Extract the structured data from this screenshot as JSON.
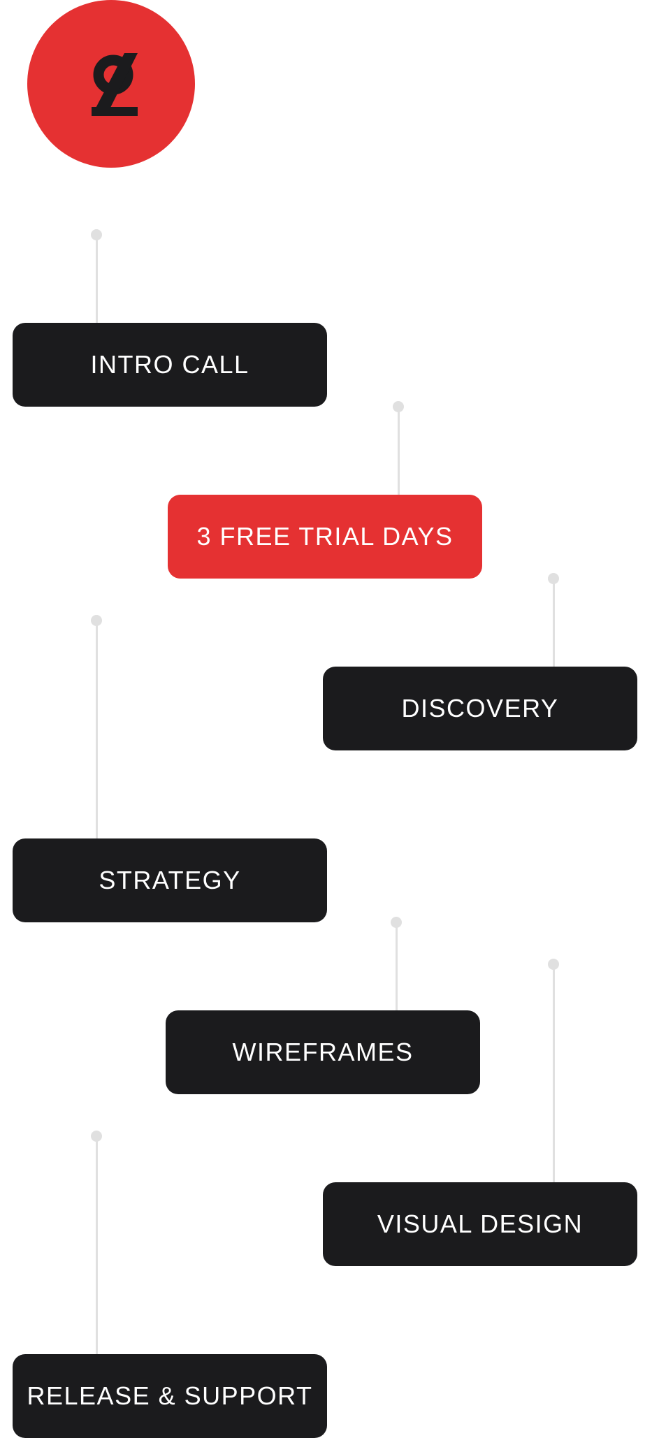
{
  "brand": {
    "logo_icon": "brand-glyph-icon",
    "logo_color": "#e53132",
    "glyph_color": "#1b1b1d"
  },
  "colors": {
    "step_dark": "#1b1b1d",
    "step_accent": "#e53132",
    "step_text": "#ffffff",
    "connector": "#e0e0e0"
  },
  "steps": [
    {
      "label": "INTRO CALL"
    },
    {
      "label": "3 FREE TRIAL DAYS"
    },
    {
      "label": "DISCOVERY"
    },
    {
      "label": "STRATEGY"
    },
    {
      "label": "WIREFRAMES"
    },
    {
      "label": "VISUAL DESIGN"
    },
    {
      "label": "RELEASE & SUPPORT"
    }
  ]
}
